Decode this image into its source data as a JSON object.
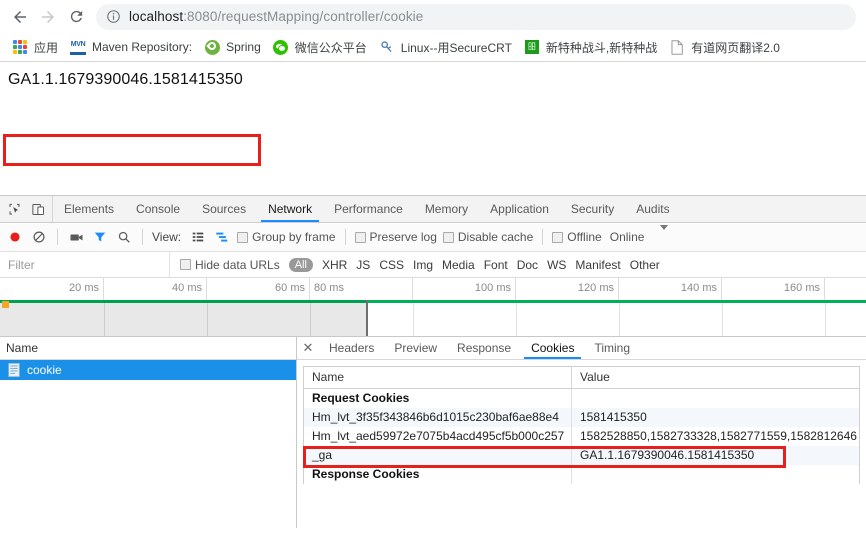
{
  "browser": {
    "nav": {
      "back": "back-arrow",
      "forward": "forward-arrow",
      "reload": "reload-arrow"
    },
    "omnibox": {
      "info_icon": "info-circle-icon",
      "url_host": "localhost",
      "url_path": ":8080/requestMapping/controller/cookie",
      "url_full": "localhost:8080/requestMapping/controller/cookie"
    },
    "bookmarks": [
      {
        "label": "应用",
        "icon": "apps-grid-icon"
      },
      {
        "label": "Maven Repository:",
        "icon": "maven-icon"
      },
      {
        "label": "Spring",
        "icon": "spring-leaf-icon"
      },
      {
        "label": "微信公众平台",
        "icon": "wechat-icon"
      },
      {
        "label": "Linux--用SecureCRT",
        "icon": "secure-crt-icon"
      },
      {
        "label": "新特种战斗,新特种战",
        "icon": "green-square-icon"
      },
      {
        "label": "有道网页翻译2.0",
        "icon": "document-icon"
      }
    ]
  },
  "page": {
    "body_text": "GA1.1.1679390046.1581415350",
    "highlight_color": "#e8201c"
  },
  "devtools": {
    "tool_icons": [
      "inspect-element-icon",
      "device-toolbar-icon"
    ],
    "tabs": [
      {
        "label": "Elements",
        "active": false
      },
      {
        "label": "Console",
        "active": false
      },
      {
        "label": "Sources",
        "active": false
      },
      {
        "label": "Network",
        "active": true
      },
      {
        "label": "Performance",
        "active": false
      },
      {
        "label": "Memory",
        "active": false
      },
      {
        "label": "Application",
        "active": false
      },
      {
        "label": "Security",
        "active": false
      },
      {
        "label": "Audits",
        "active": false
      }
    ],
    "network_toolbar": {
      "record_icon": "record-circle-icon",
      "clear_icon": "clear-prohibited-icon",
      "screenshot_icon": "camera-icon",
      "filter_icon": "funnel-icon",
      "search_icon": "magnifier-icon",
      "view_label": "View:",
      "view_list_icon": "list-view-icon",
      "view_waterfall_icon": "waterfall-view-icon",
      "group_by_frame": "Group by frame",
      "preserve_log": "Preserve log",
      "disable_cache": "Disable cache",
      "offline": "Offline",
      "online": "Online",
      "overflow_icon": "chevron-down-icon",
      "accent_color": "#1a8cff",
      "record_color": "#e8201c"
    },
    "filter_bar": {
      "placeholder": "Filter",
      "hide_data_urls": "Hide data URLs",
      "types": [
        "All",
        "XHR",
        "JS",
        "CSS",
        "Img",
        "Media",
        "Font",
        "Doc",
        "WS",
        "Manifest",
        "Other"
      ],
      "active_type": "All"
    },
    "overview": {
      "ticks": [
        "20 ms",
        "40 ms",
        "60 ms",
        "80 ms",
        "100 ms",
        "120 ms",
        "140 ms",
        "160 ms"
      ],
      "timeline_color": "#00b05a",
      "selection_end_ms": 80
    },
    "request_list": {
      "column_header": "Name",
      "rows": [
        {
          "name": "cookie",
          "icon": "document-icon",
          "selected": true
        }
      ],
      "selected_color": "#1a90e8"
    },
    "detail_panel": {
      "close_icon": "close-icon",
      "tabs": [
        {
          "label": "Headers",
          "active": false
        },
        {
          "label": "Preview",
          "active": false
        },
        {
          "label": "Response",
          "active": false
        },
        {
          "label": "Cookies",
          "active": true
        },
        {
          "label": "Timing",
          "active": false
        }
      ],
      "cookies_table": {
        "headers": [
          "Name",
          "Value"
        ],
        "rows": [
          {
            "name": "Request Cookies",
            "value": "",
            "type": "section"
          },
          {
            "name": "Hm_lvt_3f35f343846b6d1015c230baf6ae88e4",
            "value": "1581415350",
            "type": "data"
          },
          {
            "name": "Hm_lvt_aed59972e7075b4acd495cf5b000c257",
            "value": "1582528850,1582733328,1582771559,1582812646",
            "type": "data"
          },
          {
            "name": "_ga",
            "value": "GA1.1.1679390046.1581415350",
            "type": "data",
            "highlighted": true
          },
          {
            "name": "Response Cookies",
            "value": "",
            "type": "section"
          }
        ]
      }
    }
  }
}
